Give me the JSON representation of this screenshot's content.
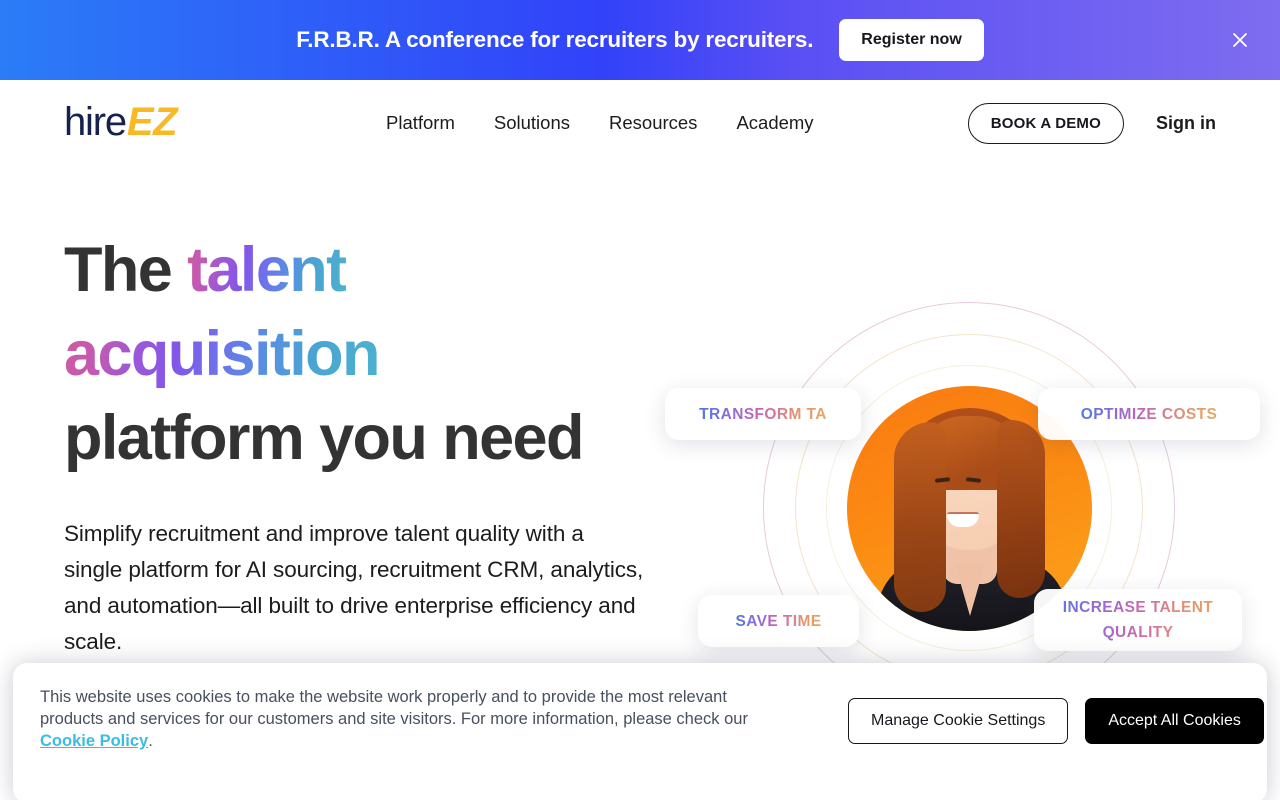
{
  "promo_banner": {
    "message": "F.R.B.R. A conference for recruiters by recruiters.",
    "cta_label": "Register now",
    "close_icon": "close-icon",
    "gradient_from": "#2b7cf7",
    "gradient_mid": "#3242f9",
    "gradient_to": "#7e6df0"
  },
  "header": {
    "logo": {
      "part1": "hire",
      "part2": "EZ",
      "color1": "#16214c",
      "color2": "#f7b924"
    },
    "nav": [
      {
        "label": "Platform"
      },
      {
        "label": "Solutions"
      },
      {
        "label": "Resources"
      },
      {
        "label": "Academy"
      }
    ],
    "book_demo_label": "BOOK A DEMO",
    "sign_in_label": "Sign in"
  },
  "hero": {
    "headline_part1": "The ",
    "headline_gradient1": "talent",
    "headline_gradient2": "acquisition",
    "headline_part2": "platform you need",
    "subtext": "Simplify recruitment and improve talent quality with a single platform for AI sourcing, recruitment CRM, analytics, and automation—all built to drive enterprise efficiency and scale.",
    "headline_gradient_from": "#d05a9e",
    "headline_gradient_mid": "#8356e8",
    "headline_gradient_to": "#4cb2cf",
    "headline_text_color": "#333333"
  },
  "hero_visual": {
    "photo_alt": "smiling woman with long red hair in a black top",
    "photo_background_color": "#fa7a12",
    "ring_outer_color": "#e8c9df",
    "ring_mid_color": "#f3e4c9",
    "ring_inner_color": "#f7efdc",
    "cards": [
      {
        "label": "TRANSFORM TA"
      },
      {
        "label": "OPTIMIZE COSTS"
      },
      {
        "label": "SAVE TIME"
      },
      {
        "label": "INCREASE TALENT QUALITY"
      }
    ]
  },
  "cookie_banner": {
    "text_before_link": "This website uses cookies to make the website work properly and to provide the most relevant products and services for our customers and site visitors. For more information, please check our ",
    "link_label": "Cookie Policy",
    "text_after_link": ".",
    "link_color": "#39bde5",
    "manage_label": "Manage Cookie Settings",
    "accept_label": "Accept All Cookies"
  },
  "chat_widget": {
    "icon": "chat-bubble-icon",
    "color": "#5b4bf0"
  }
}
